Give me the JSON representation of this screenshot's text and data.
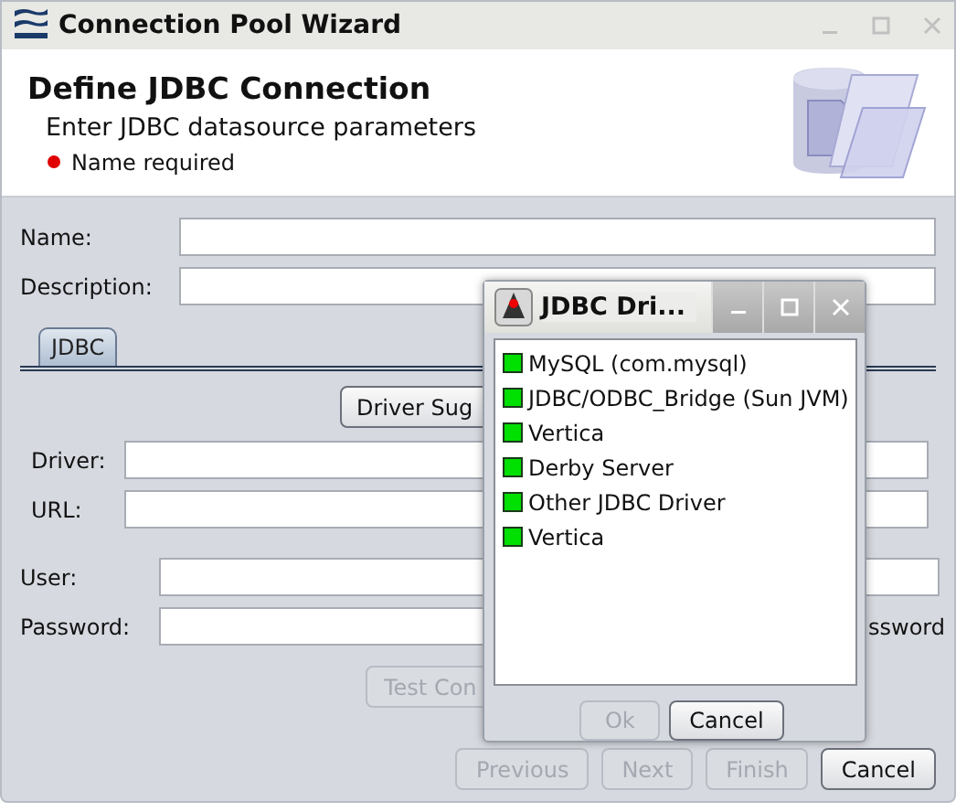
{
  "window": {
    "title": "Connection Pool Wizard"
  },
  "header": {
    "title": "Define JDBC Connection",
    "subtitle": "Enter JDBC datasource parameters",
    "message": "Name required"
  },
  "fields": [
    {
      "label": "Name:"
    },
    {
      "label": "Description:"
    }
  ],
  "tabs": [
    {
      "label": "JDBC",
      "selected": true
    }
  ],
  "suggest_button": {
    "label": "Driver Sug",
    "disabled": false
  },
  "driver_fields": [
    {
      "label": "Driver:"
    },
    {
      "label": "URL:"
    }
  ],
  "user_fields": [
    {
      "label": "User:"
    },
    {
      "label": "Password:",
      "trailing_text": "ssword"
    }
  ],
  "test_button": {
    "label": "Test Con",
    "disabled": true
  },
  "buttons": [
    {
      "label": "Previous",
      "disabled": true
    },
    {
      "label": "Next",
      "disabled": true
    },
    {
      "label": "Finish",
      "disabled": true
    },
    {
      "label": "Cancel",
      "disabled": false
    }
  ],
  "popup": {
    "title": "JDBC Dri...",
    "items": [
      {
        "label": "MySQL (com.mysql)",
        "selected": false
      },
      {
        "label": "JDBC/ODBC_Bridge (Sun JVM)",
        "selected": false
      },
      {
        "label": "Vertica",
        "selected": false
      },
      {
        "label": "Derby Server",
        "selected": false
      },
      {
        "label": "Other JDBC Driver",
        "selected": false
      },
      {
        "label": "Vertica",
        "selected": false
      }
    ],
    "buttons": [
      {
        "label": "Ok",
        "disabled": true
      },
      {
        "label": "Cancel",
        "disabled": false
      }
    ]
  }
}
